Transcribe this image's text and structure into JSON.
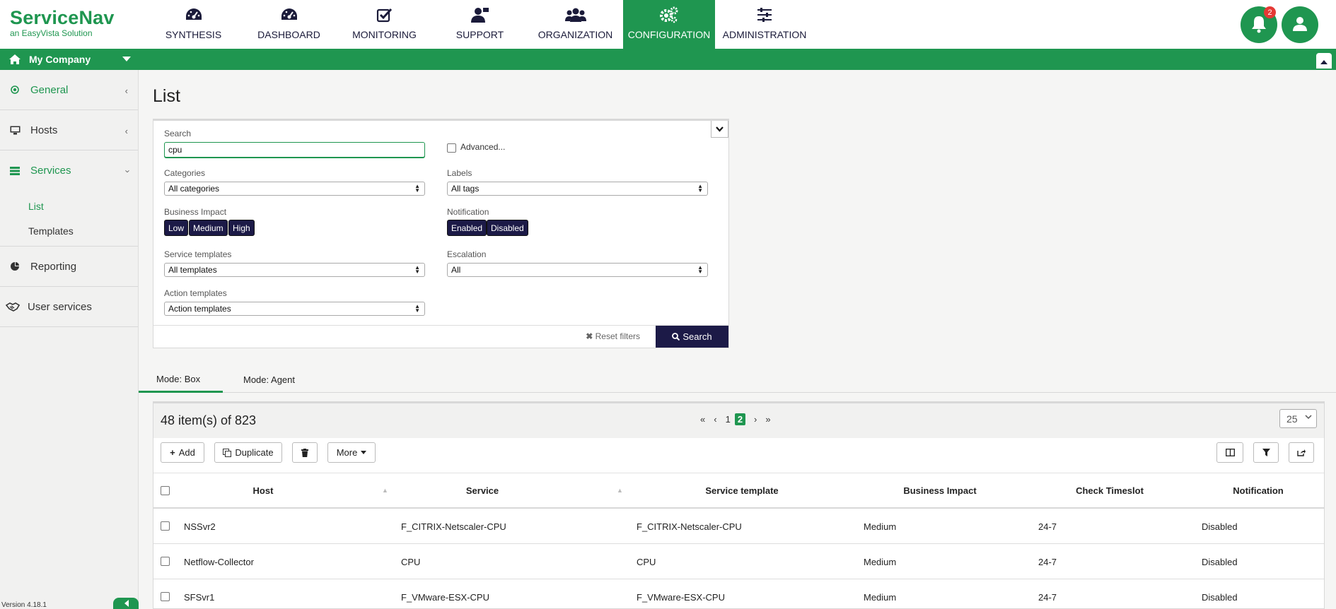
{
  "brand": {
    "name": "ServiceNav",
    "tagline": "an EasyVista Solution"
  },
  "nav": [
    {
      "label": "SYNTHESIS",
      "icon": "gauge-icon"
    },
    {
      "label": "DASHBOARD",
      "icon": "gauge-icon"
    },
    {
      "label": "MONITORING",
      "icon": "check-square-icon"
    },
    {
      "label": "SUPPORT",
      "icon": "support-user-icon"
    },
    {
      "label": "ORGANIZATION",
      "icon": "users-icon"
    },
    {
      "label": "CONFIGURATION",
      "icon": "gears-icon",
      "active": true
    },
    {
      "label": "ADMINISTRATION",
      "icon": "sliders-icon"
    }
  ],
  "notifications": {
    "count": "2"
  },
  "company": {
    "label": "My Company"
  },
  "sidebar": {
    "sections": [
      {
        "label": "General",
        "icon": "circle-dot-icon"
      },
      {
        "label": "Hosts",
        "icon": "monitor-icon"
      },
      {
        "label": "Services",
        "icon": "list-icon",
        "expanded": true
      },
      {
        "label": "Reporting",
        "icon": "pie-chart-icon"
      },
      {
        "label": "User services",
        "icon": "handshake-icon"
      }
    ],
    "subitems": [
      {
        "label": "List",
        "active": true
      },
      {
        "label": "Templates"
      }
    ],
    "version": "Version 4.18.1"
  },
  "page": {
    "title": "List"
  },
  "filters": {
    "search_label": "Search",
    "search_value": "cpu",
    "advanced_label": "Advanced...",
    "categories_label": "Categories",
    "categories_value": "All categories",
    "labels_label": "Labels",
    "labels_value": "All tags",
    "impact_label": "Business Impact",
    "impact_options": [
      "Low",
      "Medium",
      "High"
    ],
    "notification_label": "Notification",
    "notification_options": [
      "Enabled",
      "Disabled"
    ],
    "templates_label": "Service templates",
    "templates_value": "All templates",
    "escalation_label": "Escalation",
    "escalation_value": "All",
    "action_label": "Action templates",
    "action_value": "Action templates",
    "reset_label": "Reset filters",
    "search_button": "Search"
  },
  "modes": [
    {
      "label": "Mode: Box",
      "active": true
    },
    {
      "label": "Mode: Agent"
    }
  ],
  "table": {
    "count": "48 item(s) of 823",
    "pager": {
      "first": "«",
      "prev": "‹",
      "pages": [
        "1",
        "2"
      ],
      "current": "2",
      "next": "›",
      "last": "»"
    },
    "per_page": "25",
    "toolbar": {
      "add": "Add",
      "duplicate": "Duplicate",
      "more": "More"
    },
    "columns": [
      "Host",
      "Service",
      "Service template",
      "Business Impact",
      "Check Timeslot",
      "Notification"
    ],
    "rows": [
      [
        "NSSvr2",
        "F_CITRIX-Netscaler-CPU",
        "F_CITRIX-Netscaler-CPU",
        "Medium",
        "24-7",
        "Disabled"
      ],
      [
        "Netflow-Collector",
        "CPU",
        "CPU",
        "Medium",
        "24-7",
        "Disabled"
      ],
      [
        "SFSvr1",
        "F_VMware-ESX-CPU",
        "F_VMware-ESX-CPU",
        "Medium",
        "24-7",
        "Disabled"
      ]
    ]
  },
  "colors": {
    "accent": "#1f9650",
    "dark": "#1c1a47"
  }
}
